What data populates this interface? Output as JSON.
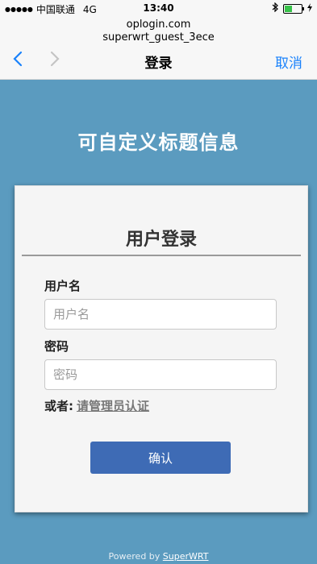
{
  "status_bar": {
    "signal": "●●●●●",
    "carrier": "中国联通",
    "network": "4G",
    "time": "13:40"
  },
  "browser": {
    "url_host": "oplogin.com",
    "url_path": "superwrt_guest_3ece",
    "title": "登录",
    "cancel_label": "取消"
  },
  "page": {
    "heading": "可自定义标题信息"
  },
  "login_card": {
    "title": "用户登录",
    "username_label": "用户名",
    "username_placeholder": "用户名",
    "password_label": "密码",
    "password_placeholder": "密码",
    "alt_prefix": "或者:",
    "alt_link": "请管理员认证",
    "confirm_label": "确认"
  },
  "footer": {
    "powered_by": "Powered by",
    "brand": "SuperWRT"
  }
}
